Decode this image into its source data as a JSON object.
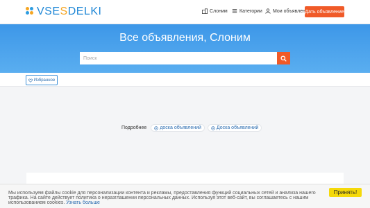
{
  "header": {
    "logo_primary": "VSE",
    "logo_accent": "S",
    "logo_rest": "DELKI",
    "nav": {
      "cities": "Слоним",
      "categories": "Категории",
      "my_ads": "Мои объявления"
    },
    "post_button": "Дать объявление"
  },
  "hero": {
    "title": "Все объявления, Слоним",
    "search_placeholder": "Поиск"
  },
  "subbar": {
    "favorites_label": "Избранное"
  },
  "tags": {
    "label": "Подробнее",
    "items": [
      "доска объявлений",
      "Доска объявлений"
    ]
  },
  "cookie": {
    "text": "Мы используем файлы cookie для персонализации контента и рекламы, предоставления функций социальных сетей и анализа нашего трафика. На сайте действует политика о неразглашении персональных данных. Используя этот веб-сайт, вы соглашаетесь с нашим использованием cookies.",
    "link": "Узнать больше",
    "accept": "Принять!"
  },
  "colors": {
    "brand_blue": "#1f87d6",
    "brand_orange": "#f5a623",
    "cta_orange": "#f05a28",
    "hero_blue": "#3d97e8",
    "accept_yellow": "#f5d90a"
  },
  "icons": [
    "buildings-icon",
    "list-icon",
    "user-icon",
    "search-icon",
    "heart-icon",
    "plus-circle-icon"
  ]
}
